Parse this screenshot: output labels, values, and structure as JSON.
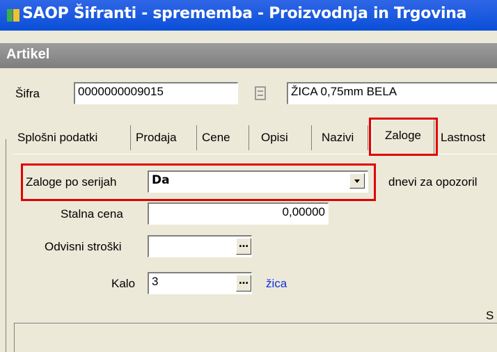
{
  "window": {
    "title": "SAOP Šifranti - sprememba - Proizvodnja in Trgovina"
  },
  "section": {
    "title": "Artikel"
  },
  "header": {
    "sifra_label": "Šifra",
    "sifra_value": "0000000009015",
    "name_value": "ŽICA 0,75mm BELA"
  },
  "tabs": [
    {
      "label": "Splošni podatki"
    },
    {
      "label": "Prodaja"
    },
    {
      "label": "Cene"
    },
    {
      "label": "Opisi"
    },
    {
      "label": "Nazivi"
    },
    {
      "label": "Zaloge",
      "active": true
    },
    {
      "label": "Lastnost"
    }
  ],
  "zaloge": {
    "po_serijah_label": "Zaloge po serijah",
    "po_serijah_value": "Da",
    "dnevi_label": "dnevi za opozoril",
    "stalna_cena_label": "Stalna cena",
    "stalna_cena_value": "0,00000",
    "odvisni_stroski_label": "Odvisni stroški",
    "odvisni_stroski_value": "",
    "kalo_label": "Kalo",
    "kalo_value": "3",
    "kalo_link": "žica",
    "cut_label": "S"
  },
  "colors": {
    "highlight": "#e00000",
    "link": "#1030e0",
    "titlebar": "#0a4fd8"
  }
}
